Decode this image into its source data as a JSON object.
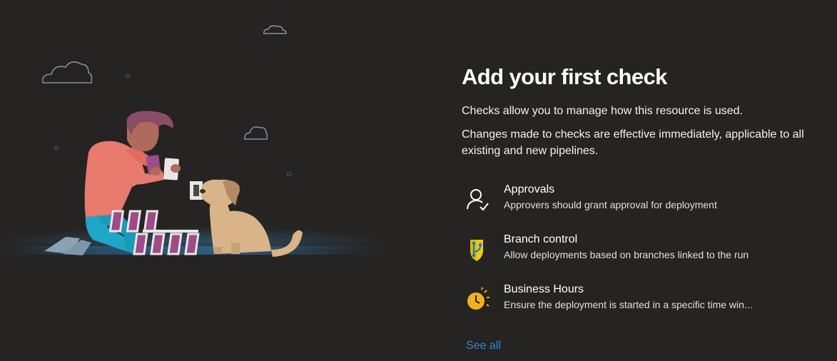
{
  "heading": "Add your first check",
  "description_1": "Checks allow you to manage how this resource is used.",
  "description_2": "Changes made to checks are effective immediately, applicable to all existing and new pipelines.",
  "checks": [
    {
      "name": "Approvals",
      "description": "Approvers should grant approval for deployment",
      "icon": "approval-person-icon"
    },
    {
      "name": "Branch control",
      "description": "Allow deployments based on branches linked to the run",
      "icon": "branch-shield-icon"
    },
    {
      "name": "Business Hours",
      "description": "Ensure the deployment is started in a specific time win...",
      "icon": "clock-sun-icon"
    }
  ],
  "see_all": "See all",
  "colors": {
    "background": "#252423",
    "link": "#2b88d8",
    "branch_icon_yellow": "#f2c811",
    "clock_icon_yellow": "#f3b11d"
  }
}
